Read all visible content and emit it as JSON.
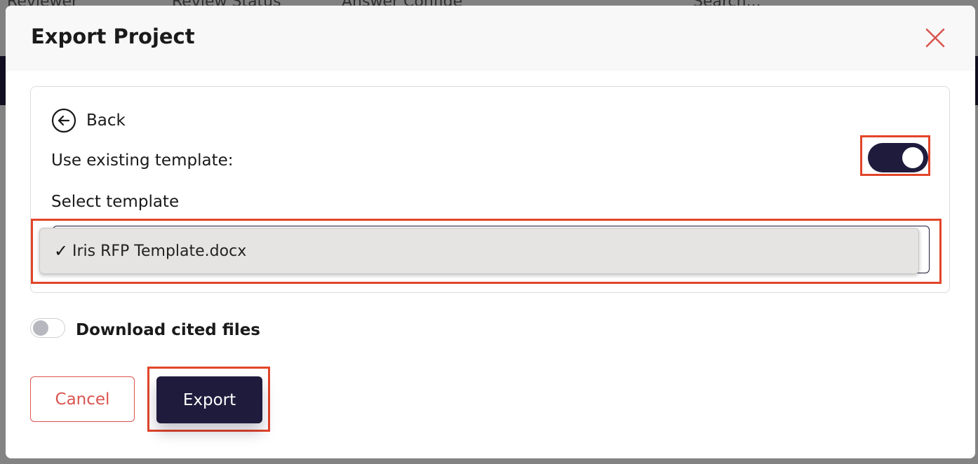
{
  "background": {
    "topbar_items": [
      "Reviewer",
      "Review Status",
      "Answer Confide",
      "Search..."
    ]
  },
  "modal": {
    "title": "Export Project",
    "close_icon": "close-icon"
  },
  "template_panel": {
    "back_label": "Back",
    "use_existing_label": "Use existing template:",
    "use_existing_on": true,
    "select_label": "Select template",
    "selected_option": {
      "check": "✓",
      "label": "Iris RFP Template.docx"
    }
  },
  "cited_files": {
    "label": "Download cited files",
    "on": false
  },
  "actions": {
    "cancel_label": "Cancel",
    "export_label": "Export"
  },
  "colors": {
    "primary": "#1f1b3d",
    "danger": "#d9544f",
    "highlight": "#e2452a"
  }
}
